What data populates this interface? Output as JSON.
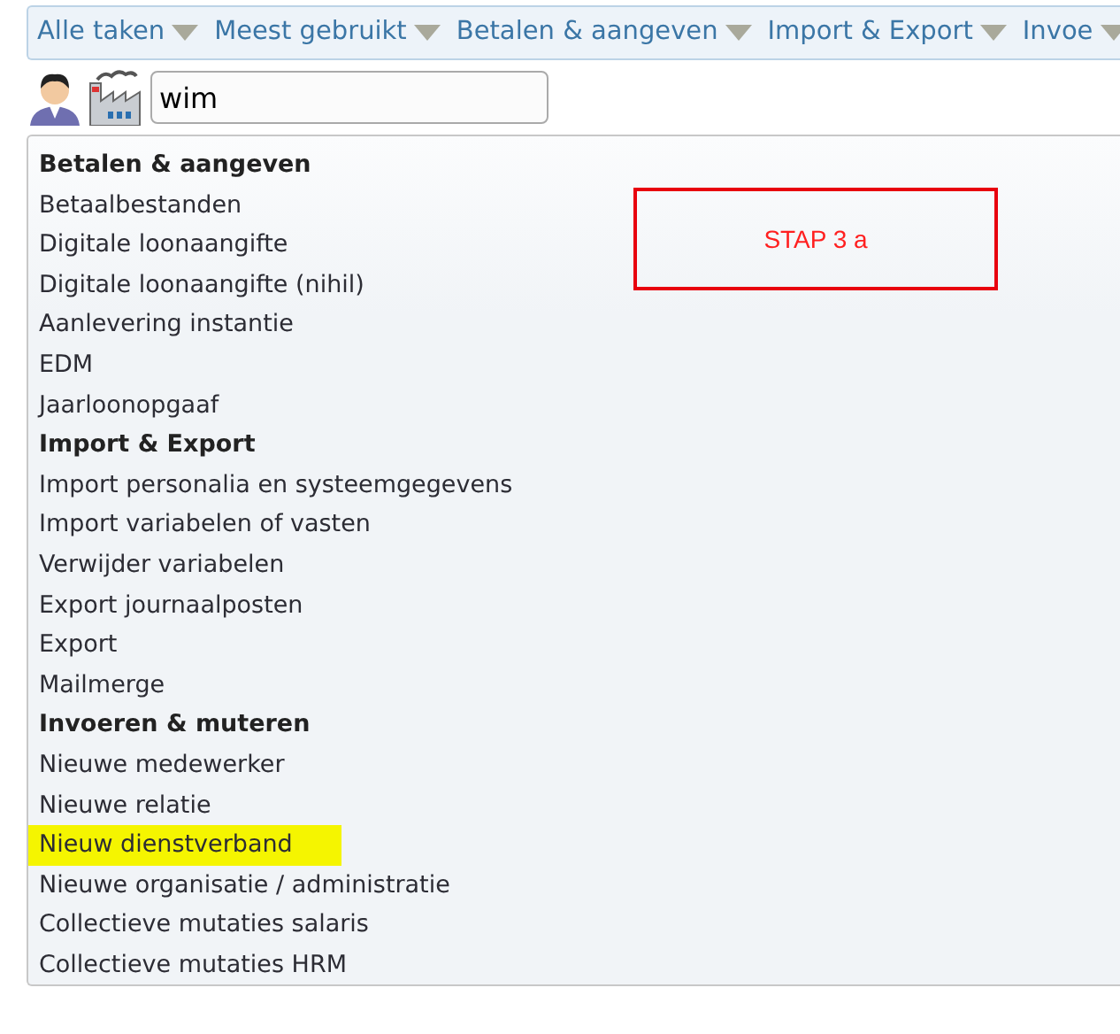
{
  "menu_bar": [
    {
      "label": "Alle taken"
    },
    {
      "label": "Meest gebruikt"
    },
    {
      "label": "Betalen & aangeven"
    },
    {
      "label": "Import & Export"
    },
    {
      "label": "Invoe"
    }
  ],
  "search": {
    "value": "wim"
  },
  "results": [
    {
      "kind": "heading",
      "label": "Betalen & aangeven",
      "highlighted": false
    },
    {
      "kind": "item",
      "label": "Betaalbestanden",
      "highlighted": false
    },
    {
      "kind": "item",
      "label": "Digitale loonaangifte",
      "highlighted": false
    },
    {
      "kind": "item",
      "label": "Digitale loonaangifte (nihil)",
      "highlighted": false
    },
    {
      "kind": "item",
      "label": "Aanlevering instantie",
      "highlighted": false
    },
    {
      "kind": "item",
      "label": "EDM",
      "highlighted": false
    },
    {
      "kind": "item",
      "label": "Jaarloonopgaaf",
      "highlighted": false
    },
    {
      "kind": "heading",
      "label": "Import & Export",
      "highlighted": false
    },
    {
      "kind": "item",
      "label": "Import personalia en systeemgegevens",
      "highlighted": false
    },
    {
      "kind": "item",
      "label": "Import variabelen of vasten",
      "highlighted": false
    },
    {
      "kind": "item",
      "label": "Verwijder variabelen",
      "highlighted": false
    },
    {
      "kind": "item",
      "label": "Export journaalposten",
      "highlighted": false
    },
    {
      "kind": "item",
      "label": "Export",
      "highlighted": false
    },
    {
      "kind": "item",
      "label": "Mailmerge",
      "highlighted": false
    },
    {
      "kind": "heading",
      "label": "Invoeren & muteren",
      "highlighted": false
    },
    {
      "kind": "item",
      "label": "Nieuwe medewerker",
      "highlighted": false
    },
    {
      "kind": "item",
      "label": "Nieuwe relatie",
      "highlighted": false
    },
    {
      "kind": "item",
      "label": "Nieuw dienstverband",
      "highlighted": true
    },
    {
      "kind": "item",
      "label": "Nieuwe organisatie / administratie",
      "highlighted": false
    },
    {
      "kind": "item",
      "label": "Collectieve mutaties salaris",
      "highlighted": false
    },
    {
      "kind": "item",
      "label": "Collectieve mutaties HRM",
      "highlighted": false
    }
  ],
  "annotation": {
    "label": "STAP 3 a"
  }
}
